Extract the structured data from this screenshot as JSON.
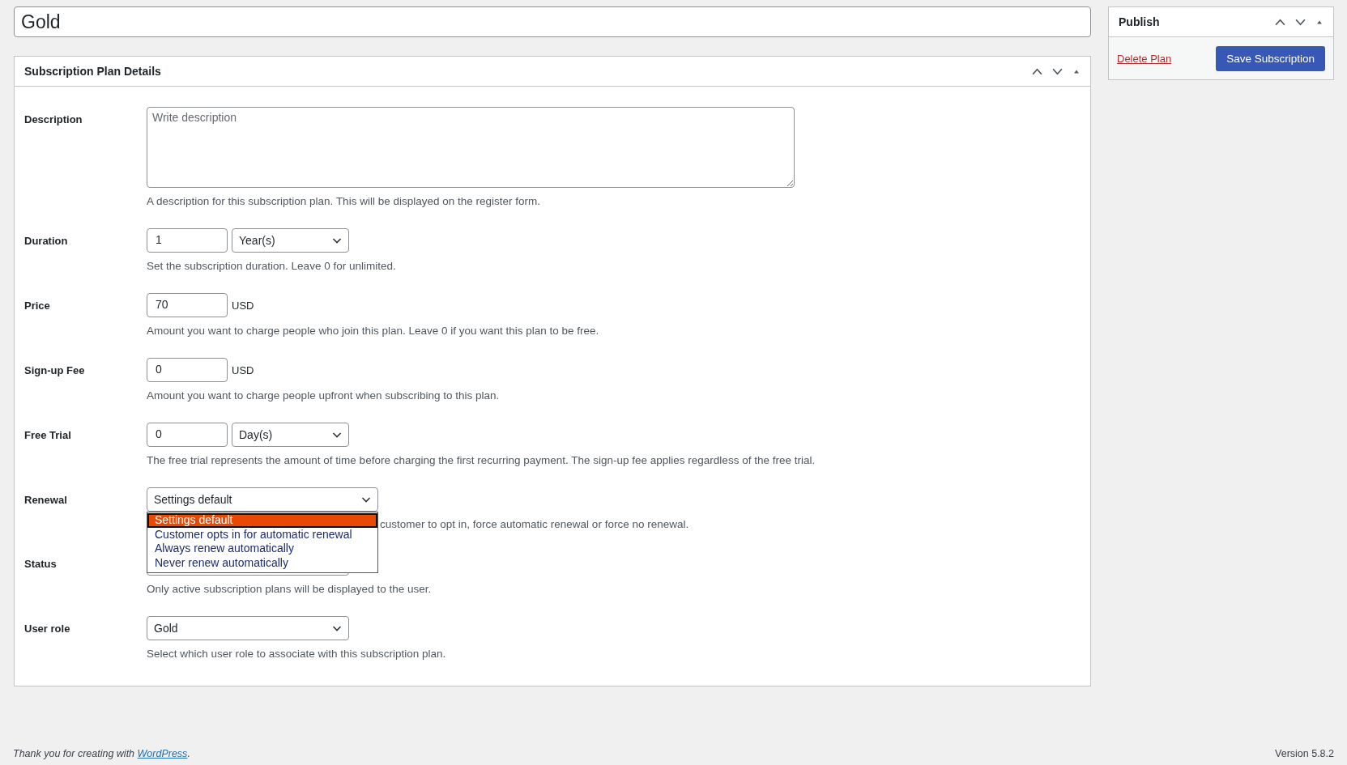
{
  "title_field": {
    "value": "Gold"
  },
  "details_panel": {
    "title": "Subscription Plan Details",
    "fields": [
      {
        "kind": "textarea",
        "label": "Description",
        "placeholder": "Write description",
        "help": "A description for this subscription plan. This will be displayed on the register form."
      },
      {
        "kind": "number_select",
        "label": "Duration",
        "value": "1",
        "unit": "Year(s)",
        "help": "Set the subscription duration. Leave 0 for unlimited."
      },
      {
        "kind": "number_unit",
        "label": "Price",
        "value": "70",
        "unit": "USD",
        "help": "Amount you want to charge people who join this plan. Leave 0 if you want this plan to be free."
      },
      {
        "kind": "number_unit",
        "label": "Sign-up Fee",
        "value": "0",
        "unit": "USD",
        "help": "Amount you want to charge people upfront when subscribing to this plan."
      },
      {
        "kind": "number_select",
        "label": "Free Trial",
        "value": "0",
        "unit": "Day(s)",
        "help": "The free trial represents the amount of time before charging the first recurring payment. The sign-up fee applies regardless of the free trial."
      },
      {
        "kind": "select_open",
        "label": "Renewal",
        "value": "Settings default",
        "help": "customer to opt in, force automatic renewal or force no renewal.",
        "options": [
          {
            "label": "Settings default",
            "selected": true
          },
          {
            "label": "Customer opts in for automatic renewal",
            "selected": false
          },
          {
            "label": "Always renew automatically",
            "selected": false
          },
          {
            "label": "Never renew automatically",
            "selected": false
          }
        ]
      },
      {
        "kind": "select",
        "label": "Status",
        "help": "Only active subscription plans will be displayed to the user."
      },
      {
        "kind": "select",
        "label": "User role",
        "value": "Gold",
        "help": "Select which user role to associate with this subscription plan."
      }
    ]
  },
  "publish_panel": {
    "title": "Publish",
    "delete_link": "Delete Plan",
    "save_button": "Save Subscription"
  },
  "footer": {
    "text": "Thank you for creating with ",
    "link": "WordPress",
    "text_end": "."
  },
  "version": "Version 5.8.2"
}
